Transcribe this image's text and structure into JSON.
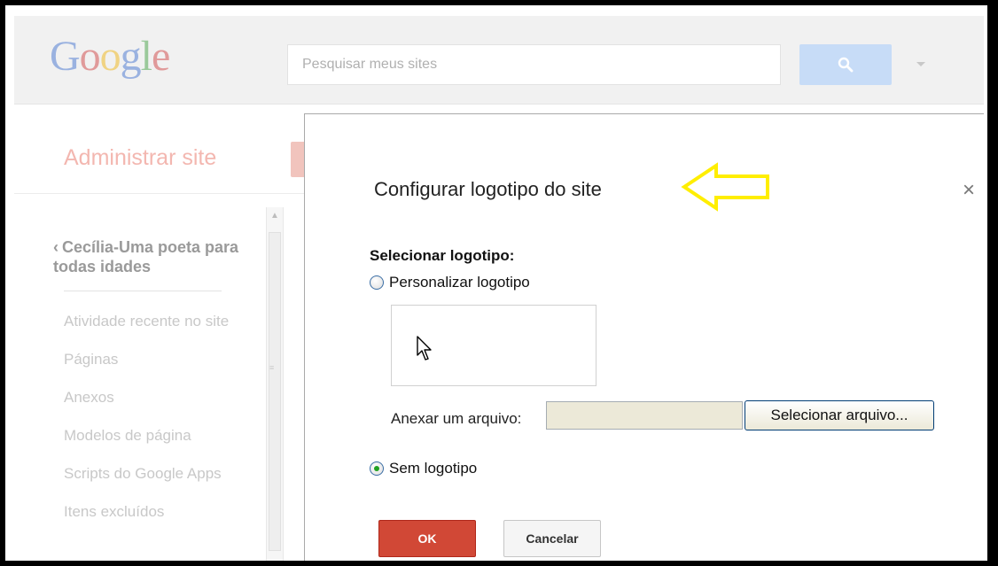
{
  "header": {
    "logo_text": "Google",
    "search_placeholder": "Pesquisar meus sites"
  },
  "sidebar": {
    "title": "Administrar site",
    "site_name": "Cecília-Uma poeta para todas idades",
    "items": [
      {
        "label": "Atividade recente no site"
      },
      {
        "label": "Páginas"
      },
      {
        "label": "Anexos"
      },
      {
        "label": "Modelos de página"
      },
      {
        "label": "Scripts do Google Apps"
      },
      {
        "label": "Itens excluídos"
      }
    ]
  },
  "dialog": {
    "title": "Configurar logotipo do site",
    "close_symbol": "×",
    "section_label": "Selecionar logotipo:",
    "option_custom": "Personalizar logotipo",
    "option_custom_checked": false,
    "attach_label": "Anexar um arquivo:",
    "file_value": "",
    "file_button": "Selecionar arquivo...",
    "option_none": "Sem logotipo",
    "option_none_checked": true,
    "ok_label": "OK",
    "cancel_label": "Cancelar"
  },
  "annotation": {
    "arrow_color": "#ffee00"
  },
  "colors": {
    "ok_button": "#d14836",
    "search_button": "#c7dcf7"
  }
}
